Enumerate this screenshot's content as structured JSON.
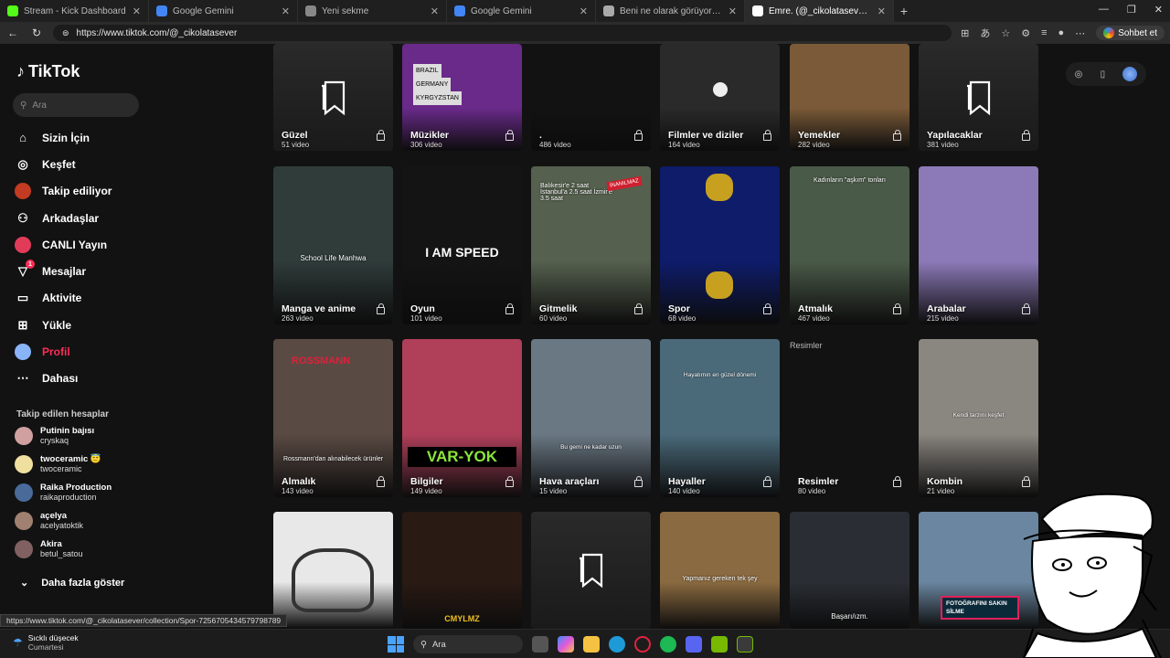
{
  "browser": {
    "tabs": [
      {
        "title": "Stream - Kick Dashboard",
        "color": "#53fc18"
      },
      {
        "title": "Google Gemini",
        "color": "#4285f4"
      },
      {
        "title": "Yeni sekme",
        "color": "#888888"
      },
      {
        "title": "Google Gemini",
        "color": "#4285f4"
      },
      {
        "title": "Beni ne olarak görüyorsun",
        "color": "#aaaaaa"
      },
      {
        "title": "Emre. (@_cikolatasever) | TikTok",
        "color": "#ffffff"
      }
    ],
    "url": "https://www.tiktok.com/@_cikolatasever",
    "chat_button": "Sohbet et",
    "status_link": "https://www.tiktok.com/@_cikolatasever/collection/Spor-7256705434579798789"
  },
  "sidebar": {
    "logo": "TikTok",
    "search_placeholder": "Ara",
    "nav": [
      {
        "label": "Sizin İçin",
        "icon": "home-icon"
      },
      {
        "label": "Keşfet",
        "icon": "compass-icon"
      },
      {
        "label": "Takip ediliyor",
        "icon": "avatar"
      },
      {
        "label": "Arkadaşlar",
        "icon": "friends-icon"
      },
      {
        "label": "CANLI Yayın",
        "icon": "avatar"
      },
      {
        "label": "Mesajlar",
        "icon": "inbox-icon",
        "badge": "1"
      },
      {
        "label": "Aktivite",
        "icon": "activity-icon"
      },
      {
        "label": "Yükle",
        "icon": "upload-icon"
      },
      {
        "label": "Profil",
        "icon": "avatar"
      },
      {
        "label": "Dahası",
        "icon": "more-icon"
      }
    ],
    "followed_title": "Takip edilen hesaplar",
    "accounts": [
      {
        "name": "Putinin bajısı",
        "user": "cryskaq"
      },
      {
        "name": "twoceramic 😇",
        "user": "twoceramic"
      },
      {
        "name": "Raika Production",
        "user": "raikaproduction"
      },
      {
        "name": "açelya",
        "user": "acelyatoktik"
      },
      {
        "name": "Akira",
        "user": "betul_satou"
      }
    ],
    "show_more": "Daha fazla göster"
  },
  "collections": [
    {
      "title": "Güzel",
      "count": "51 video",
      "bg": "#232323",
      "empty": true
    },
    {
      "title": "Müzikler",
      "count": "306 video",
      "bg": "#6a2a8a"
    },
    {
      "title": ".",
      "count": "486 video",
      "bg": "#121212"
    },
    {
      "title": "Filmler ve diziler",
      "count": "164 video",
      "bg": "#2a2a2a"
    },
    {
      "title": "Yemekler",
      "count": "282 video",
      "bg": "#7a5a38"
    },
    {
      "title": "Yapılacaklar",
      "count": "381 video",
      "bg": "#232323",
      "empty": true
    },
    {
      "title": "Manga ve anime",
      "count": "263 video",
      "bg": "#2f3c3a"
    },
    {
      "title": "Oyun",
      "count": "101 video",
      "bg": "#141414"
    },
    {
      "title": "Gitmelik",
      "count": "60 video",
      "bg": "#55604e"
    },
    {
      "title": "Spor",
      "count": "68 video",
      "bg": "#0e1c6a"
    },
    {
      "title": "Atmalık",
      "count": "467 video",
      "bg": "#4a5a48"
    },
    {
      "title": "Arabalar",
      "count": "215 video",
      "bg": "#8c7ab8"
    },
    {
      "title": "Almalık",
      "count": "143 video",
      "bg": "#5a4a44"
    },
    {
      "title": "Bilgiler",
      "count": "149 video",
      "bg": "#b03f5a"
    },
    {
      "title": "Hava araçları",
      "count": "15 video",
      "bg": "#6a7884"
    },
    {
      "title": "Hayaller",
      "count": "140 video",
      "bg": "#4a6a7a"
    },
    {
      "title": "Resimler",
      "count": "80 video",
      "bg": "#121212",
      "broken": "Resimler"
    },
    {
      "title": "Kombin",
      "count": "21 video",
      "bg": "#8a8680"
    },
    {
      "title": "",
      "count": "",
      "bg": "#e8e8e8"
    },
    {
      "title": "",
      "count": "",
      "bg": "#2a1a14"
    },
    {
      "title": "",
      "count": "",
      "bg": "#232323",
      "empty": true
    },
    {
      "title": "",
      "count": "",
      "bg": "#8a6a40"
    },
    {
      "title": "",
      "count": "",
      "bg": "#2a2e34"
    },
    {
      "title": "",
      "count": "",
      "bg": "#6a86a0"
    }
  ],
  "overlays": {
    "muzik_flags": [
      "BRAZIL",
      "GERMANY",
      "KYRGYZSTAN"
    ],
    "manga_text": "School Life Manhwa",
    "oyun_text": "I AM SPEED",
    "gitmelik_text": "Balıkesir'e 2 saat İstanbul'a 2.5 saat İzmir'e 3.5 saat",
    "gitmelik_badge": "İNANILMAZ",
    "atmalik_text": "Kadınların \"aşkım\" tonları",
    "almalik_text": "Rossmann'dan alınabilecek ürünler",
    "almalik_store": "ROSSMANN",
    "bilgiler_text": "VAR-YOK",
    "hava_text": "Bu gemi ne kadar uzun",
    "hayaller_text": "Hayatımın en güzel dönemi",
    "kombin_text": "Kendi tarzını keşfet",
    "row4_person_text": "CMYLMZ",
    "row4_sign_text": "Yapmanız gereken tek şey",
    "row4_caption": "Başarı/ızm.",
    "row4_badge": "FOTOĞRAFINI SAKIN SİLME"
  },
  "taskbar": {
    "weather_line1": "Sıcklı düşecek",
    "weather_line2": "Cumartesi",
    "search": "Ara"
  }
}
